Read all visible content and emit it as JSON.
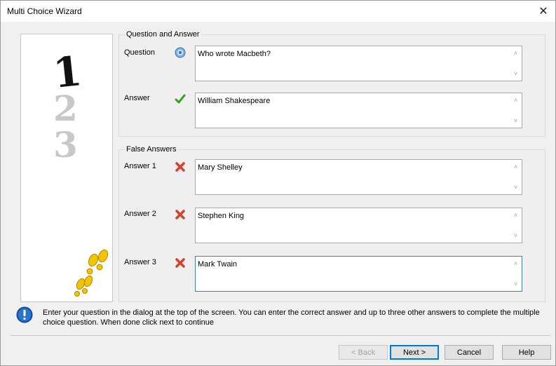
{
  "window": {
    "title": "Multi Choice Wizard",
    "close_glyph": "✕"
  },
  "sidebar": {
    "numerals": [
      "1",
      "2",
      "3"
    ]
  },
  "question_answer": {
    "group_label": "Question and Answer",
    "question": {
      "label": "Question",
      "value": "Who wrote Macbeth?",
      "icon": "question-icon"
    },
    "answer": {
      "label": "Answer",
      "value": "William Shakespeare",
      "icon": "checkmark-icon"
    }
  },
  "false_answers": {
    "group_label": "False Answers",
    "items": [
      {
        "label": "Answer 1",
        "value": "Mary Shelley",
        "icon": "cross-icon"
      },
      {
        "label": "Answer 2",
        "value": "Stephen King",
        "icon": "cross-icon"
      },
      {
        "label": "Answer 3",
        "value": "Mark Twain",
        "icon": "cross-icon"
      }
    ]
  },
  "info": {
    "icon": "info-icon",
    "text": "Enter your question in the dialog at the top of the screen. You can enter the correct answer and up to three other answers to complete the multiple choice question. When done click next to continue"
  },
  "buttons": {
    "back": "< Back",
    "next": "Next >",
    "cancel": "Cancel",
    "help": "Help"
  },
  "colors": {
    "accent": "#0078d7",
    "info_blue": "#1a5fb4",
    "check_green": "#3a9a2a",
    "cross_red": "#d4412c",
    "footprint_yellow": "#f2c400"
  }
}
